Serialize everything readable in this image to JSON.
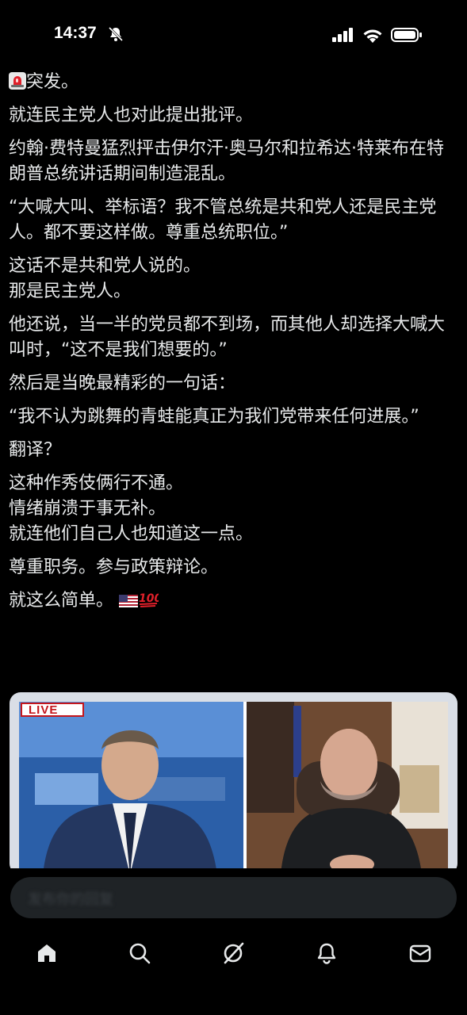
{
  "status_bar": {
    "time": "14:37",
    "icons": [
      "bell-off-icon",
      "cellular-signal-icon",
      "wifi-icon",
      "battery-icon"
    ]
  },
  "post": {
    "paragraphs": [
      "突发。",
      "就连民主党人也对此提出批评。",
      "约翰·费特曼猛烈抨击伊尔汗·奥马尔和拉希达·特莱布在特朗普总统讲话期间制造混乱。",
      "“大喊大叫、举标语？我不管总统是共和党人还是民主党人。都不要这样做。尊重总统职位。”",
      "这话不是共和党人说的。\n那是民主党人。",
      "他还说，当一半的党员都不到场，而其他人却选择大喊大叫时，“这不是我们想要的。”",
      "然后是当晚最精彩的一句话：",
      "“我不认为跳舞的青蛙能真正为我们党带来任何进展。”",
      "翻译？",
      "这种作秀伎俩行不通。\n情绪崩溃于事无补。\n就连他们自己人也知道这一点。",
      "尊重职务。参与政策辩论。",
      "就这么简单。"
    ],
    "leading_emoji": "siren-icon",
    "trailing_emojis": [
      "us-flag-icon",
      "hundred-points-icon"
    ]
  },
  "media": {
    "badge": "LIVE",
    "type": "video"
  },
  "reply": {
    "placeholder": "发布你的回复"
  },
  "tabbar": {
    "items": [
      "home",
      "search",
      "grok",
      "notifications",
      "messages"
    ],
    "active": "home"
  },
  "colors": {
    "background": "#000000",
    "text": "#e7e9ea",
    "live_red": "#c4161c",
    "reply_bar": "#1f2326"
  }
}
